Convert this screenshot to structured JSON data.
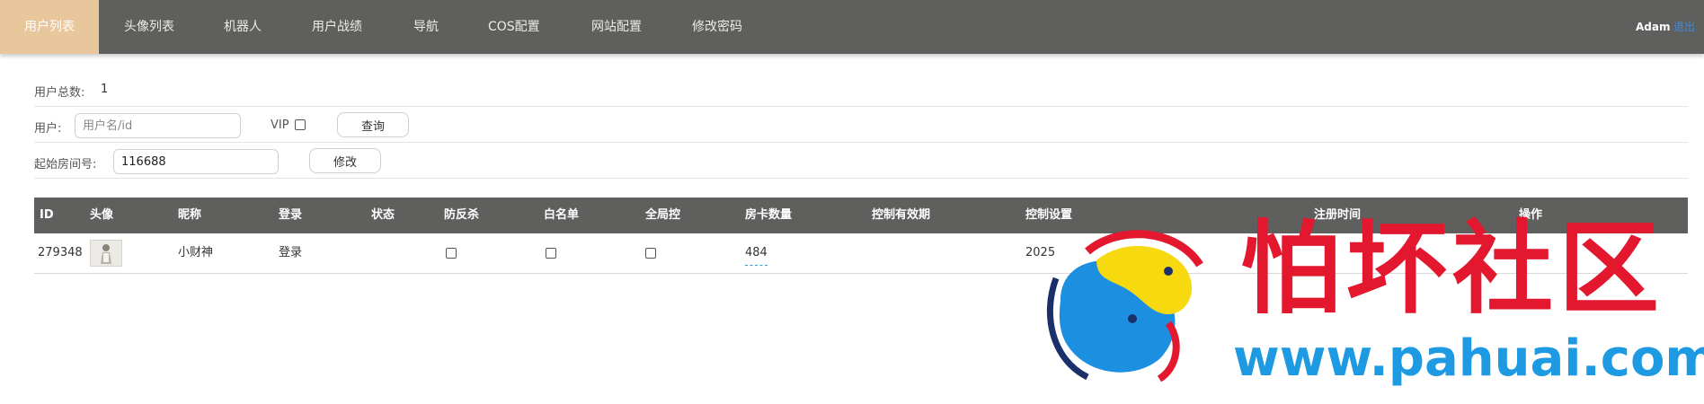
{
  "nav": {
    "items": [
      "用户列表",
      "头像列表",
      "机器人",
      "用户战绩",
      "导航",
      "COS配置",
      "网站配置",
      "修改密码"
    ],
    "active_index": 0,
    "user": "Adam",
    "logout": "退出",
    "colors": {
      "bar": "#5f5f5d",
      "active": "#e8c79c",
      "logout": "#3a8de0"
    }
  },
  "summary": {
    "label": "用户总数:",
    "value": "1"
  },
  "search": {
    "user_label": "用户:",
    "user_placeholder": "用户名/id",
    "vip_label": "VIP",
    "vip_checked": false,
    "query_button": "查询"
  },
  "room": {
    "label": "起始房间号:",
    "value": "116688",
    "modify_button": "修改"
  },
  "table": {
    "headers": [
      "ID",
      "头像",
      "昵称",
      "登录",
      "状态",
      "防反杀",
      "白名单",
      "全局控",
      "房卡数量",
      "控制有效期",
      "控制设置",
      "注册时间",
      "操作"
    ],
    "rows": [
      {
        "id": "279348",
        "nickname": "小财神",
        "login": "登录",
        "status": "",
        "anti_kill": false,
        "whitelist": false,
        "global_control": false,
        "card_count": "484",
        "control_expiry": "",
        "control_setting": "2025",
        "register_time": "",
        "actions": ""
      }
    ]
  },
  "watermark": {
    "cn": "怕坏社区",
    "url": "www.pahuai.com",
    "colors": {
      "cn": "#e3182f",
      "url": "#1d9ae2",
      "fish_yellow": "#f6d90f",
      "fish_blue": "#1d8fe0"
    },
    "logo_icon": "fish-logo-icon"
  }
}
